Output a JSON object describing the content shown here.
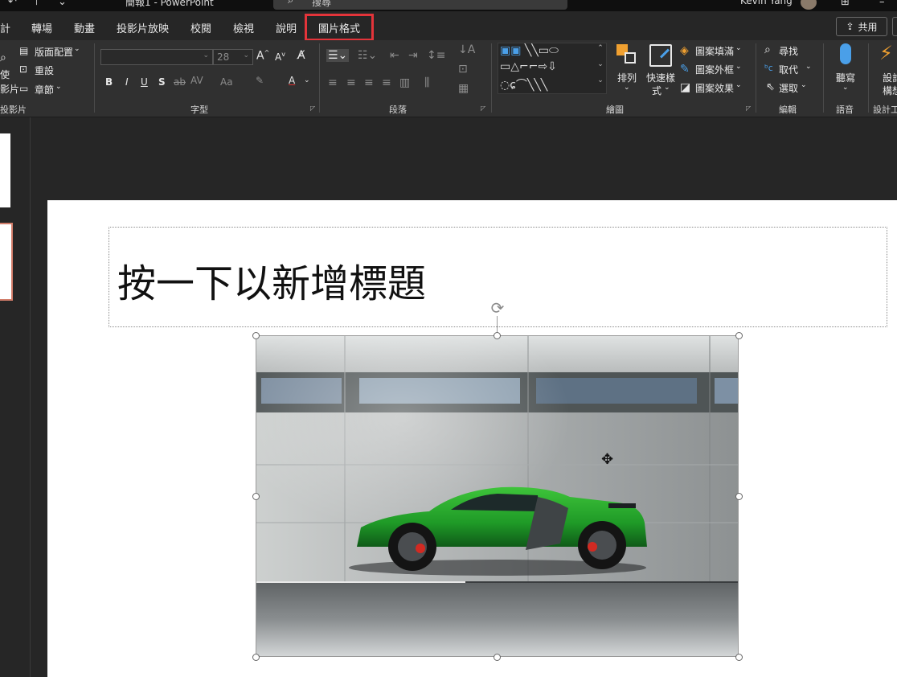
{
  "window": {
    "document_title": "簡報1 - PowerPoint",
    "search_placeholder": "搜尋",
    "user_name": "Kevin Yang"
  },
  "tabs": [
    {
      "label": "計"
    },
    {
      "label": "轉場"
    },
    {
      "label": "動畫"
    },
    {
      "label": "投影片放映"
    },
    {
      "label": "校閱"
    },
    {
      "label": "檢視"
    },
    {
      "label": "說明"
    },
    {
      "label": "圖片格式",
      "highlighted": true
    }
  ],
  "share_label": "共用",
  "ribbon": {
    "slides_group": {
      "label": "投影片",
      "reuse_label_1": "使",
      "reuse_label_2": "影片",
      "layout_label": "版面配置",
      "reset_label": "重設",
      "section_label": "章節"
    },
    "font_group": {
      "label": "字型",
      "font_name_value": "",
      "font_size_value": "28",
      "bold": "B",
      "italic": "I",
      "underline": "U",
      "shadow": "S",
      "strike": "ab",
      "spacing": "AV",
      "case": "Aa",
      "font_color": "A"
    },
    "paragraph_group": {
      "label": "段落"
    },
    "drawing_group": {
      "label": "繪圖",
      "arrange_label": "排列",
      "quick_styles_label_1": "快速樣",
      "quick_styles_label_2": "式",
      "shape_fill_label": "圖案填滿",
      "shape_outline_label": "圖案外框",
      "shape_effects_label": "圖案效果"
    },
    "editing_group": {
      "label": "編輯",
      "find_label": "尋找",
      "replace_label": "取代",
      "select_label": "選取"
    },
    "voice_group": {
      "label": "語音",
      "dictate_label": "聽寫"
    },
    "designer_group": {
      "label": "設計工",
      "design_label_1": "設計",
      "design_label_2": "構想"
    }
  },
  "slide": {
    "title_placeholder": "按一下以新增標題"
  },
  "colors": {
    "highlight_border": "#e3343a",
    "ribbon_bg": "#303030",
    "tabs_bg": "#262626",
    "car_green": "#25a02c"
  }
}
